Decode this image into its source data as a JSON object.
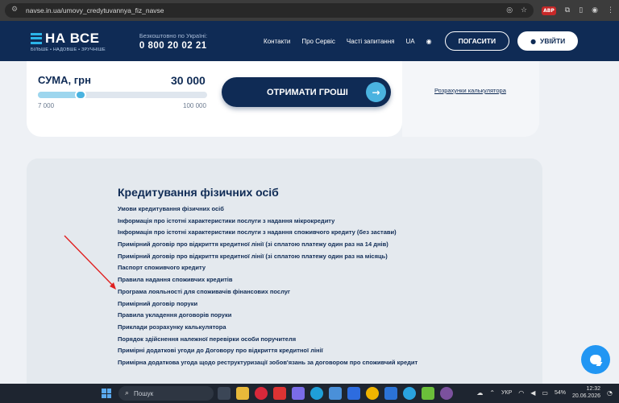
{
  "browser": {
    "url": "navse.in.ua/umovy_credytuvannya_fiz_navse",
    "adblock_label": "ABP"
  },
  "header": {
    "logo_text": "НА ВСЕ",
    "logo_tagline": "БІЛЬШЕ • НАДОВШЕ • ЗРУЧНІШЕ",
    "phone_label": "Безкоштовно по Україні:",
    "phone_number": "0 800 20 02 21",
    "nav": [
      "Контакти",
      "Про Сервіс",
      "Часті запитання",
      "UA"
    ],
    "repay_button": "ПОГАСИТИ",
    "login_button": "УВІЙТИ"
  },
  "calculator": {
    "sum_label": "СУМА, грн",
    "sum_value": "30 000",
    "min": "7 000",
    "max": "100 000",
    "slider_fraction": 0.25,
    "get_money_button": "ОТРИМАТИ ГРОШІ",
    "calc_link": "Розрахунки калькулятора"
  },
  "content": {
    "title": "Кредитування фізичних осіб",
    "links": [
      "Умови кредитування фізичних осіб",
      "Інформація про істотні характеристики послуги з надання мікрокредиту",
      "Інформація про істотні характеристики послуги з надання споживчого кредиту (без застави)",
      "Примірний договір про відкриття кредитної лінії (зі сплатою платежу один раз на 14 днів)",
      "Примірний договір про відкриття кредитної лінії (зі сплатою платежу один раз на місяць)",
      "Паспорт споживчого кредиту",
      "Правила надання споживчих кредитів",
      "Програма лояльності для споживачів фінансових послуг",
      "Примірний договір поруки",
      "Правила укладення договорів поруки",
      "Приклади розрахунку калькулятора",
      "Порядок здійснення належної перевірки особи поручителя",
      "Примірні додаткові угоди до Договору про відкриття кредитної лінії",
      "Примірна додаткова угода щодо реструктуризації зобов'язань за договором про споживчий кредит"
    ]
  },
  "taskbar": {
    "search_placeholder": "Пошук",
    "language": "УКР",
    "battery": "54%",
    "time": "12:32",
    "date": "20.06.2026"
  },
  "colors": {
    "brand_dark": "#0f2b55",
    "accent": "#4ab3e0",
    "chat": "#2196f3",
    "annotation_arrow": "#e02020"
  }
}
